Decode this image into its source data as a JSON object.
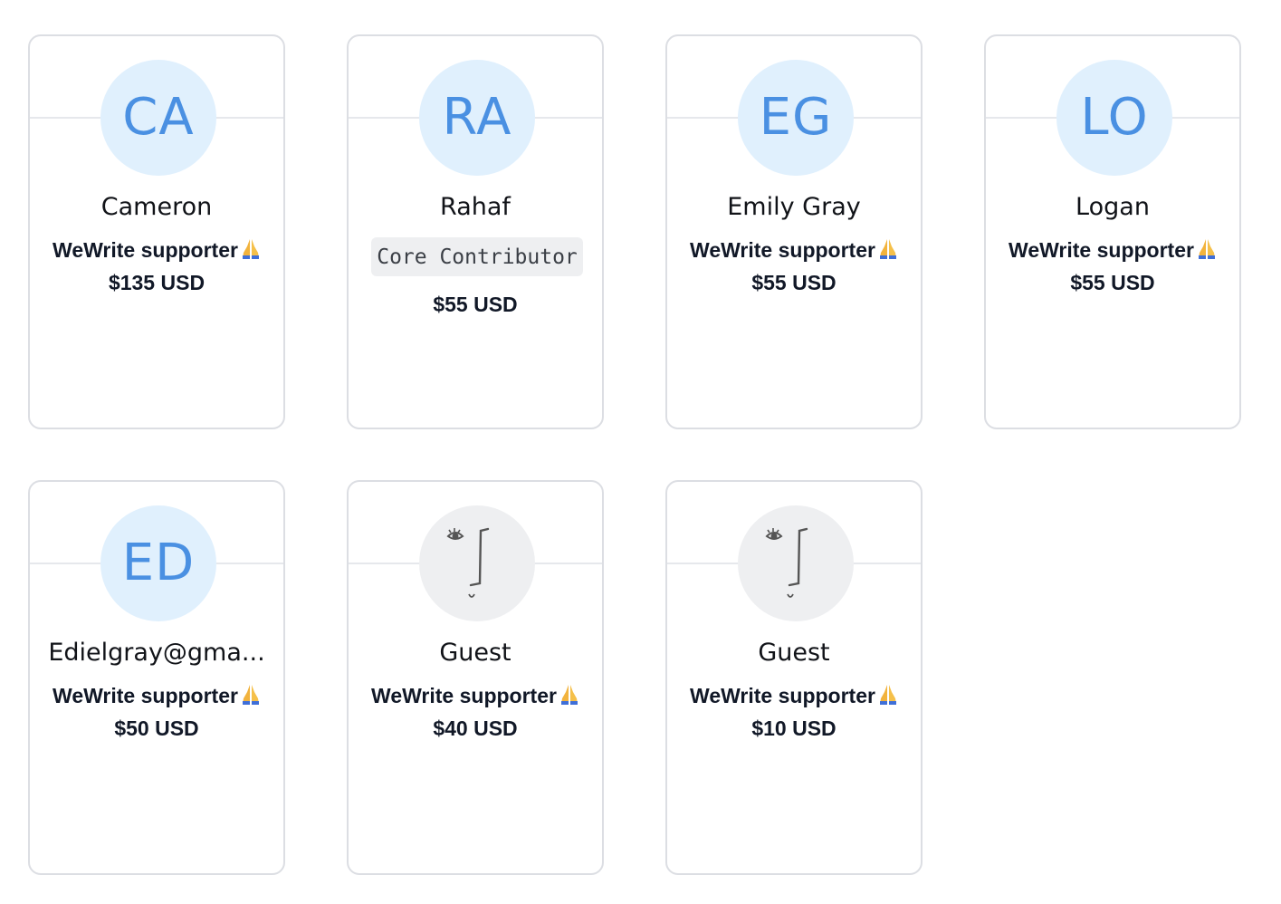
{
  "cards": [
    {
      "initials": "CA",
      "name": "Cameron",
      "tier": "WeWrite supporter",
      "tier_icon": "folded-hands-icon",
      "amount": "$135 USD"
    },
    {
      "initials": "RA",
      "name": "Rahaf",
      "badge": "Core Contributor",
      "amount": "$55 USD"
    },
    {
      "initials": "EG",
      "name": "Emily Gray",
      "tier": "WeWrite supporter",
      "tier_icon": "folded-hands-icon",
      "amount": "$55 USD"
    },
    {
      "initials": "LO",
      "name": "Logan",
      "tier": "WeWrite supporter",
      "tier_icon": "folded-hands-icon",
      "amount": "$55 USD"
    },
    {
      "initials": "ED",
      "name": "Edielgray@gma...",
      "tier": "WeWrite supporter",
      "tier_icon": "folded-hands-icon",
      "amount": "$50 USD"
    },
    {
      "avatar_icon": "guest-face-icon",
      "name": "Guest",
      "tier": "WeWrite supporter",
      "tier_icon": "folded-hands-icon",
      "amount": "$40 USD"
    },
    {
      "avatar_icon": "guest-face-icon",
      "name": "Guest",
      "tier": "WeWrite supporter",
      "tier_icon": "folded-hands-icon",
      "amount": "$10 USD"
    }
  ],
  "colors": {
    "avatar_bg": "#e0f0fd",
    "initials": "#4a90e2",
    "guest_avatar_bg": "#eeeff1",
    "card_border": "#dcdee3",
    "text": "#111827"
  }
}
